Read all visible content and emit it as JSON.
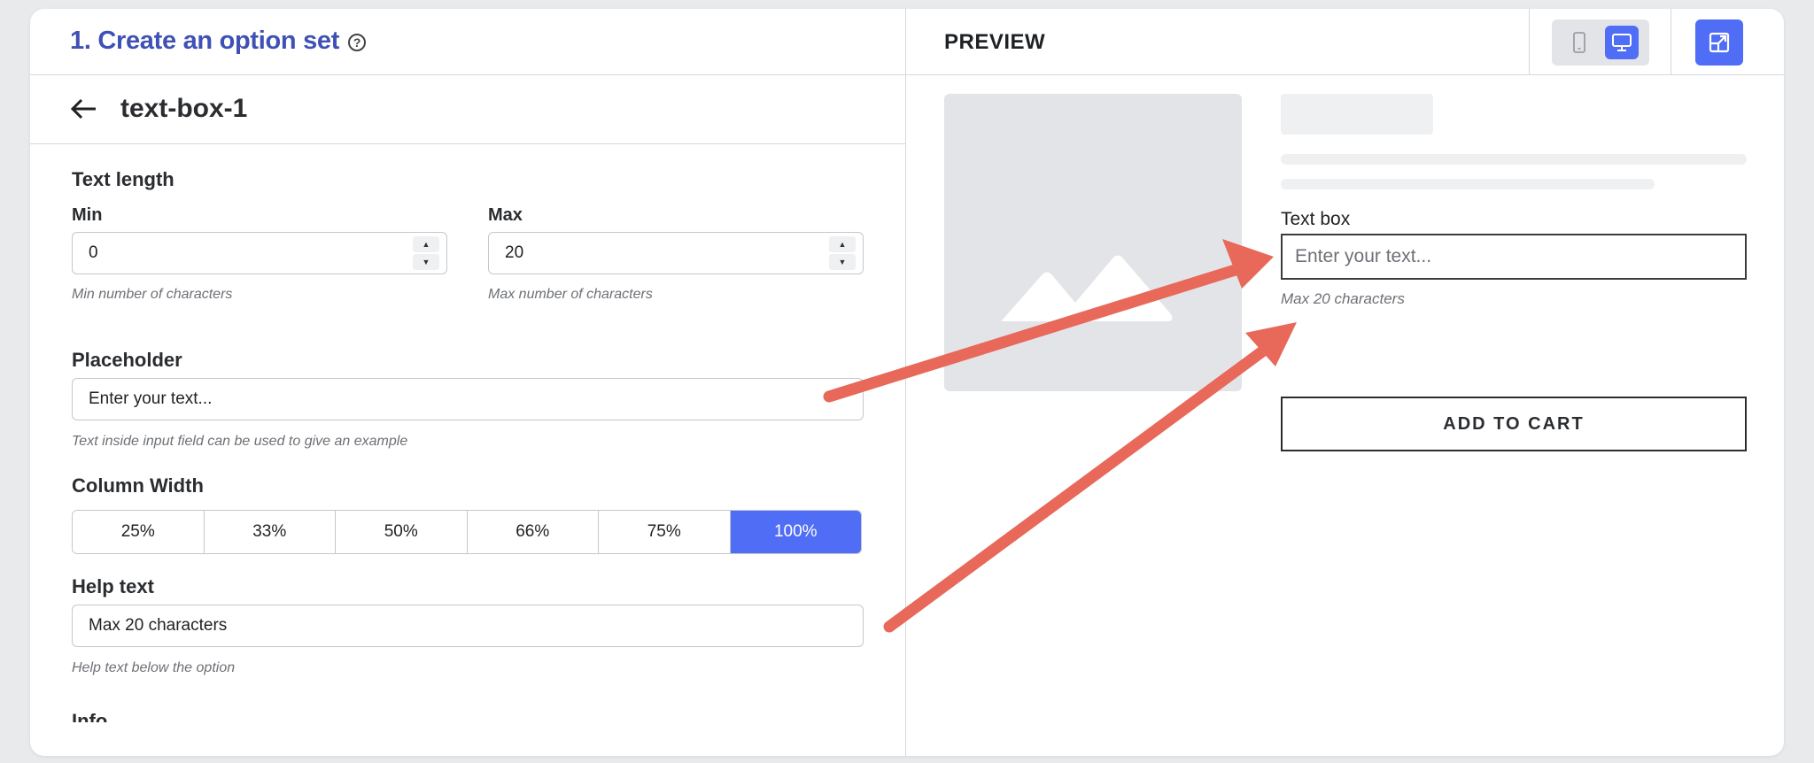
{
  "header": {
    "title": "1. Create an option set",
    "help_icon": "question-circle-icon"
  },
  "editor": {
    "back_icon": "arrow-left-icon",
    "item_name": "text-box-1",
    "text_length": {
      "label": "Text length",
      "min": {
        "label": "Min",
        "value": "0",
        "hint": "Min number of characters"
      },
      "max": {
        "label": "Max",
        "value": "20",
        "hint": "Max number of characters"
      }
    },
    "placeholder": {
      "label": "Placeholder",
      "value": "Enter your text...",
      "hint": "Text inside input field can be used to give an example"
    },
    "column_width": {
      "label": "Column Width",
      "options": [
        "25%",
        "33%",
        "50%",
        "66%",
        "75%",
        "100%"
      ],
      "selected": "100%"
    },
    "help_text": {
      "label": "Help text",
      "value": "Max 20 characters",
      "hint": "Help text below the option"
    },
    "info": {
      "label": "Info"
    }
  },
  "preview": {
    "title": "PREVIEW",
    "device_mobile_icon": "mobile-icon",
    "device_desktop_icon": "desktop-icon",
    "expand_icon": "open-external-icon",
    "image_icon": "image-placeholder-icon",
    "field_label": "Text box",
    "field_placeholder": "Enter your text...",
    "field_hint": "Max 20 characters",
    "add_to_cart": "ADD TO CART"
  },
  "colors": {
    "accent": "#4f6df5",
    "title": "#3f51b5",
    "annotation_arrow": "#e8685a"
  }
}
